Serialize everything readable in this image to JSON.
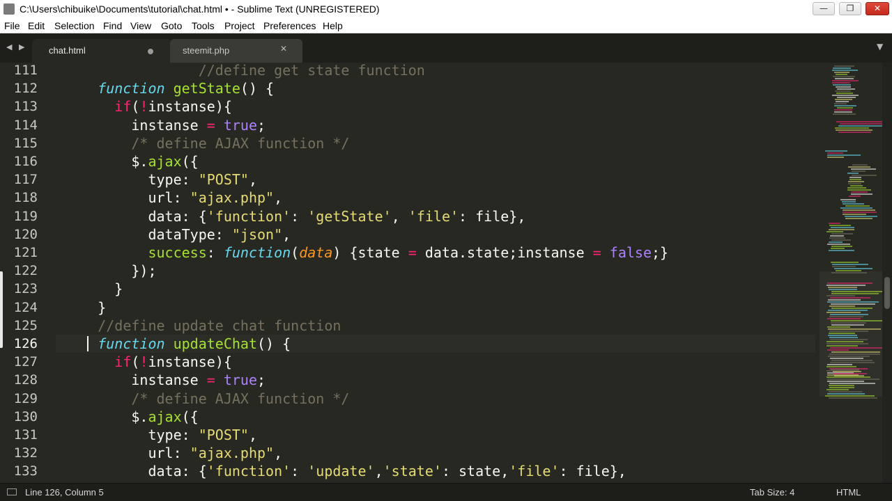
{
  "window": {
    "title": "C:\\Users\\chibuike\\Documents\\tutorial\\chat.html • - Sublime Text (UNREGISTERED)",
    "min_glyph": "—",
    "max_glyph": "❐",
    "close_glyph": "✕"
  },
  "menu": [
    "File",
    "Edit",
    "Selection",
    "Find",
    "View",
    "Goto",
    "Tools",
    "Project",
    "Preferences",
    "Help"
  ],
  "tabs": {
    "nav_left": "◀",
    "nav_right": "▶",
    "dropdown": "▼",
    "items": [
      {
        "label": "chat.html",
        "active": true,
        "dirty": true
      },
      {
        "label": "steemit.php",
        "active": false,
        "close": "✕"
      }
    ]
  },
  "editor": {
    "current_line": 126,
    "lines": [
      {
        "n": "111",
        "tokens": [
          [
            "",
            "                 "
          ],
          [
            "cm",
            "//define get state function"
          ]
        ]
      },
      {
        "n": "112",
        "tokens": [
          [
            "",
            "     "
          ],
          [
            "fn",
            "function"
          ],
          [
            "",
            " "
          ],
          [
            "name",
            "getState"
          ],
          [
            "",
            "() {"
          ]
        ]
      },
      {
        "n": "113",
        "tokens": [
          [
            "",
            "       "
          ],
          [
            "kw",
            "if"
          ],
          [
            "",
            "("
          ],
          [
            "kw",
            "!"
          ],
          [
            "",
            "instanse){"
          ]
        ]
      },
      {
        "n": "114",
        "tokens": [
          [
            "",
            "         instanse "
          ],
          [
            "kw",
            "="
          ],
          [
            "",
            " "
          ],
          [
            "num",
            "true"
          ],
          [
            "",
            ";"
          ]
        ]
      },
      {
        "n": "115",
        "tokens": [
          [
            "",
            "         "
          ],
          [
            "cm",
            "/* define AJAX function */"
          ]
        ]
      },
      {
        "n": "116",
        "tokens": [
          [
            "",
            "         $."
          ],
          [
            "name",
            "ajax"
          ],
          [
            "",
            "({"
          ]
        ]
      },
      {
        "n": "117",
        "tokens": [
          [
            "",
            "           type: "
          ],
          [
            "str",
            "\"POST\""
          ],
          [
            "",
            ","
          ]
        ]
      },
      {
        "n": "118",
        "tokens": [
          [
            "",
            "           url: "
          ],
          [
            "str",
            "\"ajax.php\""
          ],
          [
            "",
            ","
          ]
        ]
      },
      {
        "n": "119",
        "tokens": [
          [
            "",
            "           data: {"
          ],
          [
            "str",
            "'function'"
          ],
          [
            "",
            ": "
          ],
          [
            "str",
            "'getState'"
          ],
          [
            "",
            ", "
          ],
          [
            "str",
            "'file'"
          ],
          [
            "",
            ": file},"
          ]
        ]
      },
      {
        "n": "120",
        "tokens": [
          [
            "",
            "           dataType: "
          ],
          [
            "str",
            "\"json\""
          ],
          [
            "",
            ","
          ]
        ]
      },
      {
        "n": "121",
        "tokens": [
          [
            "",
            "           "
          ],
          [
            "name",
            "success"
          ],
          [
            "",
            ": "
          ],
          [
            "fn",
            "function"
          ],
          [
            "",
            "("
          ],
          [
            "param",
            "data"
          ],
          [
            "",
            ") {state "
          ],
          [
            "kw",
            "="
          ],
          [
            "",
            " data.state;instanse "
          ],
          [
            "kw",
            "="
          ],
          [
            "",
            " "
          ],
          [
            "num",
            "false"
          ],
          [
            "",
            ";}"
          ]
        ]
      },
      {
        "n": "122",
        "tokens": [
          [
            "",
            "         });"
          ]
        ]
      },
      {
        "n": "123",
        "tokens": [
          [
            "",
            "       }"
          ]
        ]
      },
      {
        "n": "124",
        "tokens": [
          [
            "",
            "     }"
          ]
        ]
      },
      {
        "n": "125",
        "tokens": [
          [
            "",
            "     "
          ],
          [
            "cm",
            "//define update chat function"
          ]
        ]
      },
      {
        "n": "126",
        "tokens": [
          [
            "",
            "     "
          ],
          [
            "fn",
            "function"
          ],
          [
            "",
            " "
          ],
          [
            "name",
            "updateChat"
          ],
          [
            "",
            "() {"
          ]
        ]
      },
      {
        "n": "127",
        "tokens": [
          [
            "",
            "       "
          ],
          [
            "kw",
            "if"
          ],
          [
            "",
            "("
          ],
          [
            "kw",
            "!"
          ],
          [
            "",
            "instanse){"
          ]
        ]
      },
      {
        "n": "128",
        "tokens": [
          [
            "",
            "         instanse "
          ],
          [
            "kw",
            "="
          ],
          [
            "",
            " "
          ],
          [
            "num",
            "true"
          ],
          [
            "",
            ";"
          ]
        ]
      },
      {
        "n": "129",
        "tokens": [
          [
            "",
            "         "
          ],
          [
            "cm",
            "/* define AJAX function */"
          ]
        ]
      },
      {
        "n": "130",
        "tokens": [
          [
            "",
            "         $."
          ],
          [
            "name",
            "ajax"
          ],
          [
            "",
            "({"
          ]
        ]
      },
      {
        "n": "131",
        "tokens": [
          [
            "",
            "           type: "
          ],
          [
            "str",
            "\"POST\""
          ],
          [
            "",
            ","
          ]
        ]
      },
      {
        "n": "132",
        "tokens": [
          [
            "",
            "           url: "
          ],
          [
            "str",
            "\"ajax.php\""
          ],
          [
            "",
            ","
          ]
        ]
      },
      {
        "n": "133",
        "tokens": [
          [
            "",
            "           data: {"
          ],
          [
            "str",
            "'function'"
          ],
          [
            "",
            ": "
          ],
          [
            "str",
            "'update'"
          ],
          [
            "",
            ","
          ],
          [
            "str",
            "'state'"
          ],
          [
            "",
            ": state,"
          ],
          [
            "str",
            "'file'"
          ],
          [
            "",
            ": file},"
          ]
        ]
      }
    ]
  },
  "status": {
    "position": "Line 126, Column 5",
    "tab_size": "Tab Size: 4",
    "syntax": "HTML"
  },
  "colors": {
    "background": "#272822",
    "keyword": "#f92672",
    "storage": "#66d9ef",
    "function_name": "#a6e22e",
    "string": "#e6db74",
    "constant": "#ae81ff",
    "comment": "#75715e",
    "parameter": "#fd971f"
  }
}
